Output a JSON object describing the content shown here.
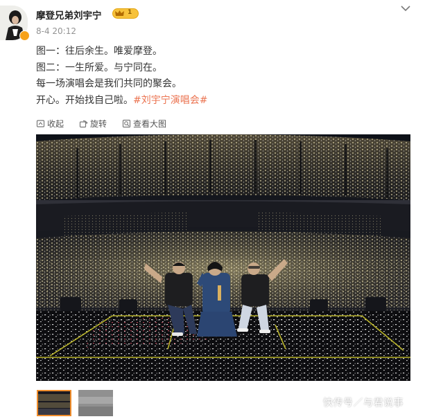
{
  "post": {
    "username": "摩登兄弟刘宇宁",
    "vip_level": "1",
    "timestamp": "8-4 20:12",
    "text_lines": [
      "图一：往后余生。唯爱摩登。",
      "图二：一生所爱。与宁同在。",
      "每一场演唱会是我们共同的聚会。"
    ],
    "last_line_text": "开心。开始找自己啦。",
    "hashtag": "#刘宇宁演唱会#"
  },
  "toolbar": {
    "collapse_label": "收起",
    "rotate_label": "旋转",
    "view_large_label": "查看大图"
  },
  "icons": {
    "menu": "chevron-down-icon",
    "collapse": "collapse-icon",
    "rotate": "rotate-icon",
    "view_large": "view-large-icon",
    "vip": "crown-icon"
  },
  "gallery": {
    "thumbnail_count": 2,
    "selected_index": 0
  },
  "watermark": "快传号／与君说事",
  "colors": {
    "hashtag": "#eb7350",
    "username": "#222222",
    "timestamp": "#939393",
    "vip_badge": "#f7c23b",
    "thumb_selected_border": "#f08c2a"
  }
}
